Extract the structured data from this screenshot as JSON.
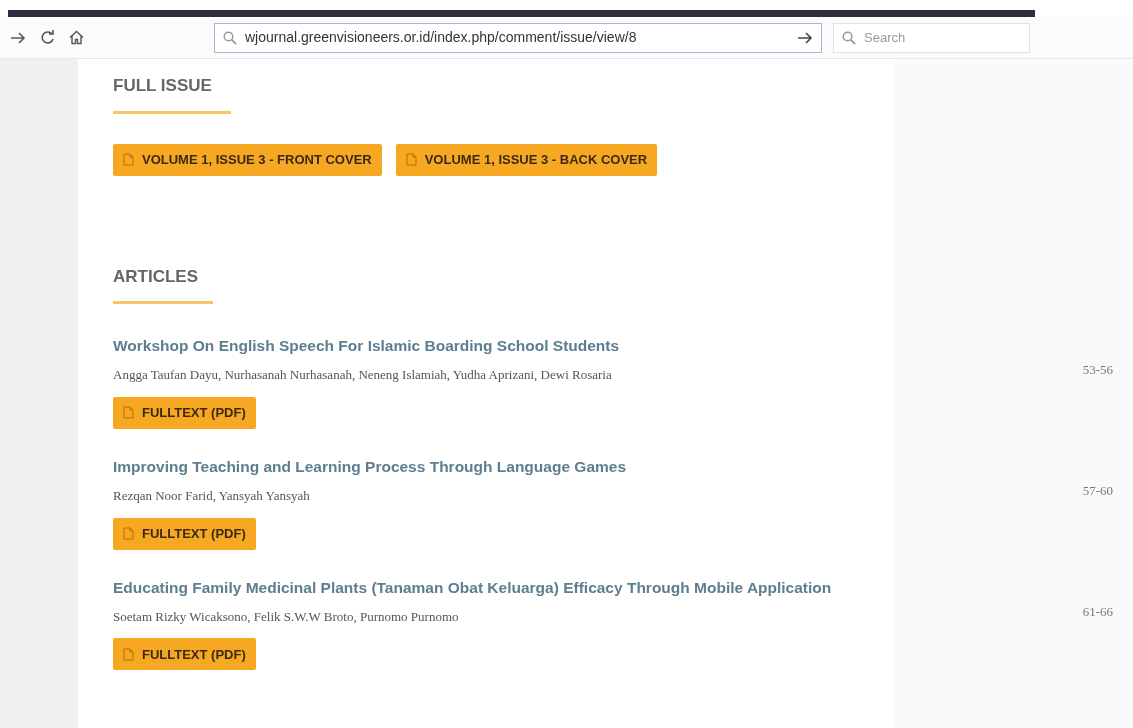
{
  "toolbar": {
    "address": {
      "value": "wjournal.greenvisioneers.or.id/index.php/comment/issue/view/8"
    },
    "search": {
      "placeholder": "Search"
    }
  },
  "full_issue": {
    "heading": "FULL ISSUE",
    "galleys": [
      "VOLUME 1, ISSUE 3 - FRONT COVER",
      "VOLUME 1, ISSUE 3 - BACK COVER"
    ]
  },
  "articles": {
    "heading": "ARTICLES",
    "items": [
      {
        "title": "Workshop On English Speech For Islamic Boarding School Students",
        "authors": "Angga Taufan Dayu, Nurhasanah Nurhasanah, Neneng Islamiah, Yudha Aprizani, Dewi Rosaria",
        "pages": "53-56",
        "galley": "FULLTEXT (PDF)"
      },
      {
        "title": "Improving Teaching and Learning Process Through Language Games",
        "authors": "Rezqan Noor Farid, Yansyah Yansyah",
        "pages": "57-60",
        "galley": "FULLTEXT (PDF)"
      },
      {
        "title": "Educating Family Medicinal Plants (Tanaman Obat Keluarga) Efficacy Through Mobile Application",
        "authors": "Soetam Rizky Wicaksono, Felik S.W.W Broto, Purnomo Purnomo",
        "pages": "61-66",
        "galley": "FULLTEXT (PDF)"
      }
    ]
  }
}
